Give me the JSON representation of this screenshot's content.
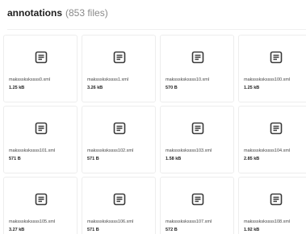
{
  "header": {
    "title": "annotations",
    "count": "(853 files)"
  },
  "files": [
    {
      "name": "makssskskssss0.xml",
      "size": "1.25 kB",
      "icon": "document-icon"
    },
    {
      "name": "makssskskssss1.xml",
      "size": "3.26 kB",
      "icon": "document-icon"
    },
    {
      "name": "makssskskssss10.xml",
      "size": "570 B",
      "icon": "document-icon"
    },
    {
      "name": "makssskskssss100.xml",
      "size": "1.25 kB",
      "icon": "document-icon"
    },
    {
      "name": "makssskskssss101.xml",
      "size": "571 B",
      "icon": "document-icon"
    },
    {
      "name": "makssskskssss102.xml",
      "size": "571 B",
      "icon": "document-icon"
    },
    {
      "name": "makssskskssss103.xml",
      "size": "1.58 kB",
      "icon": "document-icon"
    },
    {
      "name": "makssskskssss104.xml",
      "size": "2.85 kB",
      "icon": "document-icon"
    },
    {
      "name": "makssskskssss105.xml",
      "size": "3.27 kB",
      "icon": "document-icon"
    },
    {
      "name": "makssskskssss106.xml",
      "size": "571 B",
      "icon": "document-icon"
    },
    {
      "name": "makssskskssss107.xml",
      "size": "572 B",
      "icon": "document-icon"
    },
    {
      "name": "makssskskssss108.xml",
      "size": "1.92 kB",
      "icon": "document-icon"
    }
  ],
  "colors": {
    "icon": "#3a3a3a",
    "card_border": "#ededed"
  }
}
